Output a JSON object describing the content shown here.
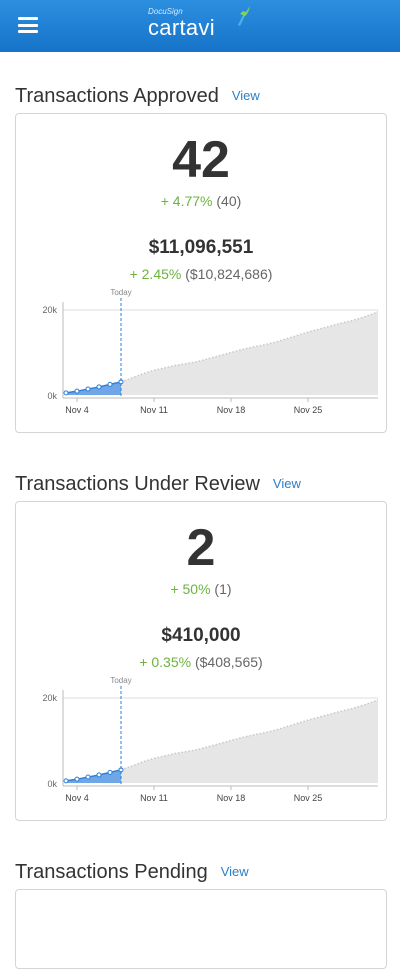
{
  "header": {
    "logo_sup": "DocuSign",
    "logo_main": "cartavi"
  },
  "sections": [
    {
      "title": "Transactions Approved",
      "view_label": "View",
      "count": "42",
      "count_delta": "+ 4.77%",
      "count_prev": "(40)",
      "amount": "$11,096,551",
      "amount_delta": "+ 2.45%",
      "amount_prev": "($10,824,686)"
    },
    {
      "title": "Transactions Under Review",
      "view_label": "View",
      "count": "2",
      "count_delta": "+ 50%",
      "count_prev": "(1)",
      "amount": "$410,000",
      "amount_delta": "+ 0.35%",
      "amount_prev": "($408,565)"
    },
    {
      "title": "Transactions Pending",
      "view_label": "View"
    }
  ],
  "chart_data": [
    {
      "type": "area",
      "today_label": "Today",
      "y_ticks": [
        "20k",
        "0k"
      ],
      "ylim": [
        0,
        20000
      ],
      "x_labels": [
        "Nov 4",
        "Nov 11",
        "Nov 18",
        "Nov 25"
      ],
      "series": [
        {
          "values": [
            500,
            900,
            1400,
            1900,
            2500,
            3100,
            4000,
            5000,
            5800,
            6400,
            7000,
            7400,
            7900,
            8600,
            9300,
            10000,
            10700,
            11300,
            11800,
            12400,
            13200,
            14000,
            14800,
            15500,
            16200,
            16900,
            17500,
            18300,
            19200,
            20200
          ]
        }
      ],
      "today_index": 5,
      "colors": {
        "past": "#2f7fd8",
        "future": "#e6e6e6"
      }
    },
    {
      "type": "area",
      "today_label": "Today",
      "y_ticks": [
        "20k",
        "0k"
      ],
      "ylim": [
        0,
        20000
      ],
      "x_labels": [
        "Nov 4",
        "Nov 11",
        "Nov 18",
        "Nov 25"
      ],
      "series": [
        {
          "values": [
            500,
            900,
            1400,
            1900,
            2500,
            3100,
            4000,
            5000,
            5800,
            6400,
            7000,
            7400,
            7900,
            8600,
            9300,
            10000,
            10700,
            11300,
            11800,
            12400,
            13200,
            14000,
            14800,
            15500,
            16200,
            16900,
            17500,
            18300,
            19200,
            20200
          ]
        }
      ],
      "today_index": 5,
      "colors": {
        "past": "#2f7fd8",
        "future": "#e6e6e6"
      }
    }
  ]
}
